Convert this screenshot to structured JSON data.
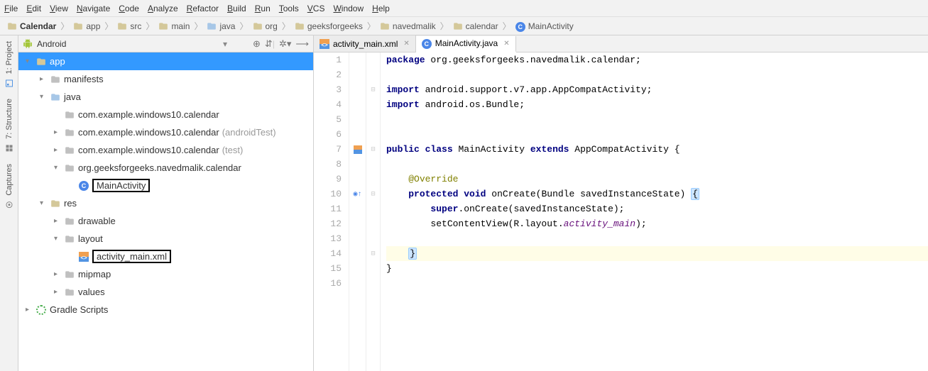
{
  "menu": [
    "File",
    "Edit",
    "View",
    "Navigate",
    "Code",
    "Analyze",
    "Refactor",
    "Build",
    "Run",
    "Tools",
    "VCS",
    "Window",
    "Help"
  ],
  "breadcrumb": [
    {
      "icon": "folder-dim",
      "label": "Calendar",
      "bold": true
    },
    {
      "icon": "folder-dim",
      "label": "app"
    },
    {
      "icon": "folder-dim",
      "label": "src"
    },
    {
      "icon": "folder-dim",
      "label": "main"
    },
    {
      "icon": "folder-ic",
      "label": "java"
    },
    {
      "icon": "folder-dim",
      "label": "org"
    },
    {
      "icon": "folder-dim",
      "label": "geeksforgeeks"
    },
    {
      "icon": "folder-dim",
      "label": "navedmalik"
    },
    {
      "icon": "folder-dim",
      "label": "calendar"
    },
    {
      "icon": "java",
      "label": "MainActivity"
    }
  ],
  "rail": [
    {
      "label": "1: Project",
      "icon": "proj"
    },
    {
      "label": "7: Structure",
      "icon": "struct"
    },
    {
      "label": "Captures",
      "icon": "cap"
    }
  ],
  "tool_header": {
    "combo": "Android"
  },
  "tree": [
    {
      "depth": 0,
      "icon": "folder-dim",
      "label": "app",
      "expand": "v",
      "selected": true
    },
    {
      "depth": 1,
      "icon": "folder-grey",
      "label": "manifests",
      "expand": ">"
    },
    {
      "depth": 1,
      "icon": "folder-ic",
      "label": "java",
      "expand": "v"
    },
    {
      "depth": 2,
      "icon": "folder-grey",
      "label": "com.example.windows10.calendar",
      "expand": ""
    },
    {
      "depth": 2,
      "icon": "folder-grey",
      "label": "com.example.windows10.calendar",
      "sub": "(androidTest)",
      "expand": ">"
    },
    {
      "depth": 2,
      "icon": "folder-grey",
      "label": "com.example.windows10.calendar",
      "sub": "(test)",
      "expand": ">"
    },
    {
      "depth": 2,
      "icon": "folder-grey",
      "label": "org.geeksforgeeks.navedmalik.calendar",
      "expand": "v"
    },
    {
      "depth": 3,
      "icon": "java",
      "label": "MainActivity",
      "expand": "",
      "boxed": true
    },
    {
      "depth": 1,
      "icon": "folder-dim",
      "label": "res",
      "expand": "v"
    },
    {
      "depth": 2,
      "icon": "folder-grey",
      "label": "drawable",
      "expand": ">"
    },
    {
      "depth": 2,
      "icon": "folder-grey",
      "label": "layout",
      "expand": "v"
    },
    {
      "depth": 3,
      "icon": "xml",
      "label": "activity_main.xml",
      "expand": "",
      "boxed": true
    },
    {
      "depth": 2,
      "icon": "folder-grey",
      "label": "mipmap",
      "expand": ">"
    },
    {
      "depth": 2,
      "icon": "folder-grey",
      "label": "values",
      "expand": ">"
    },
    {
      "depth": 0,
      "icon": "gradle",
      "label": "Gradle Scripts",
      "expand": ">"
    }
  ],
  "tabs": [
    {
      "icon": "xml",
      "label": "activity_main.xml",
      "active": false
    },
    {
      "icon": "java",
      "label": "MainActivity.java",
      "active": true
    }
  ],
  "code": {
    "lines": [
      {
        "n": 1,
        "html": "<span class='kw'>package</span> org.geeksforgeeks.navedmalik.calendar;"
      },
      {
        "n": 2,
        "html": ""
      },
      {
        "n": 3,
        "fold": "⊟",
        "html": "<span class='kw'>import</span> android.support.v7.app.AppCompatActivity;"
      },
      {
        "n": 4,
        "fold": "",
        "html": "<span class='kw'>import</span> android.os.Bundle;"
      },
      {
        "n": 5,
        "html": ""
      },
      {
        "n": 6,
        "html": ""
      },
      {
        "n": 7,
        "margin": "xml",
        "fold": "⊟",
        "html": "<span class='kw'>public</span> <span class='kw'>class</span> MainActivity <span class='kw'>extends</span> AppCompatActivity {"
      },
      {
        "n": 8,
        "html": ""
      },
      {
        "n": 9,
        "html": "    <span class='anno'>@Override</span>"
      },
      {
        "n": 10,
        "margin": "ov",
        "fold": "⊟",
        "html": "    <span class='kw'>protected</span> <span class='kw'>void</span> onCreate(Bundle savedInstanceState) <span class='br-hl'>{</span>"
      },
      {
        "n": 11,
        "html": "        <span class='kw'>super</span>.onCreate(savedInstanceState);"
      },
      {
        "n": 12,
        "html": "        setContentView(R.layout.<span class='ident'>activity_main</span>);"
      },
      {
        "n": 13,
        "html": ""
      },
      {
        "n": 14,
        "fold": "⊟",
        "hl": true,
        "html": "    <span class='br-hl'>}</span>"
      },
      {
        "n": 15,
        "html": "}"
      },
      {
        "n": 16,
        "html": ""
      }
    ]
  }
}
